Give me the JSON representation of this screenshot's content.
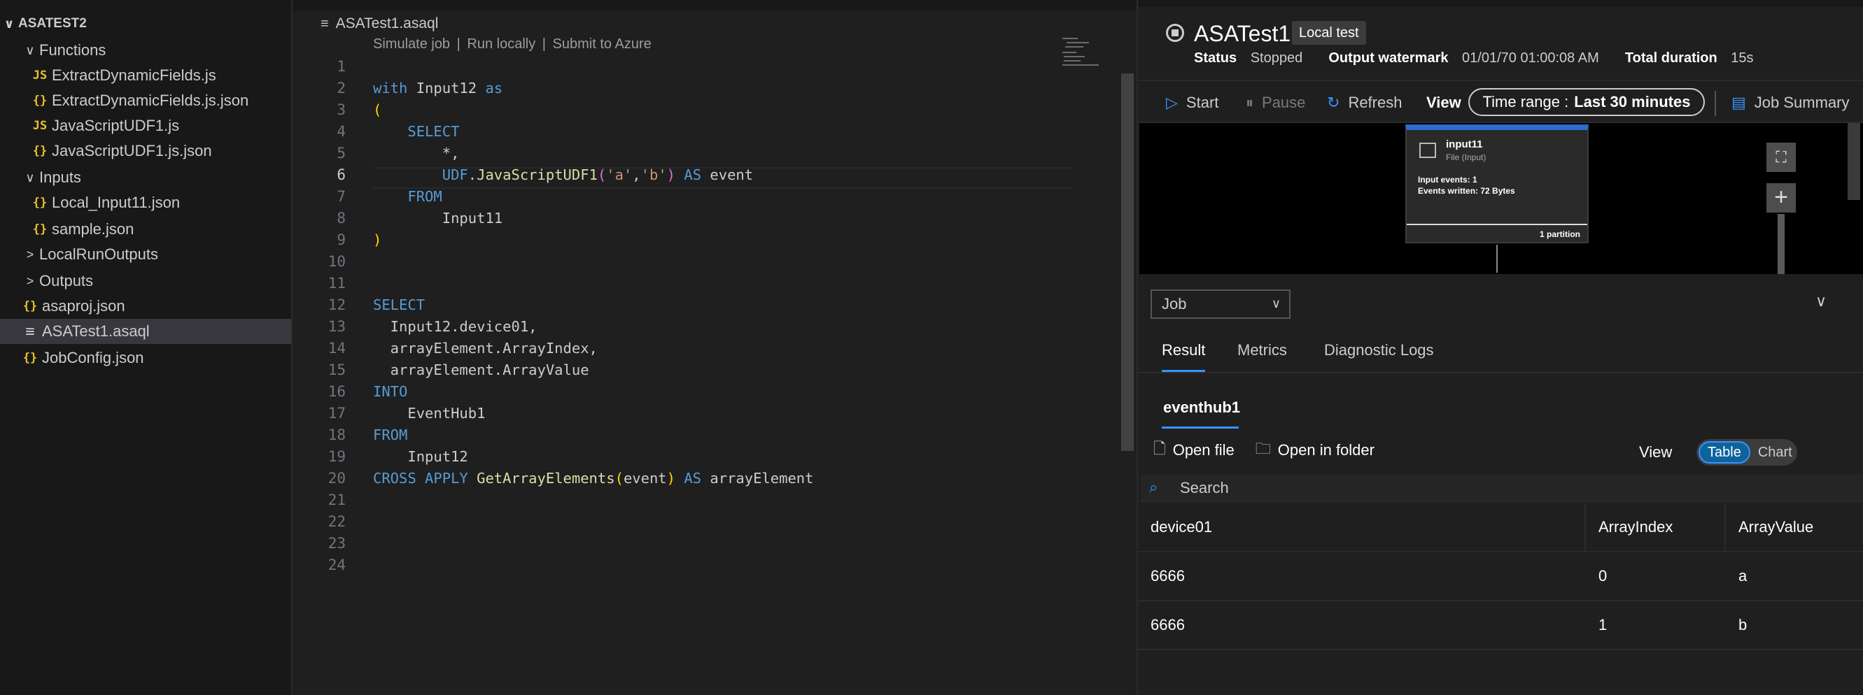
{
  "explorer": {
    "root": "ASATEST2",
    "rows": [
      {
        "label": "Functions",
        "kind": "folder-open"
      },
      {
        "label": "ExtractDynamicFields.js",
        "kind": "js"
      },
      {
        "label": "ExtractDynamicFields.js.json",
        "kind": "json"
      },
      {
        "label": "JavaScriptUDF1.js",
        "kind": "js"
      },
      {
        "label": "JavaScriptUDF1.js.json",
        "kind": "json"
      },
      {
        "label": "Inputs",
        "kind": "folder-open"
      },
      {
        "label": "Local_Input11.json",
        "kind": "json"
      },
      {
        "label": "sample.json",
        "kind": "json"
      },
      {
        "label": "LocalRunOutputs",
        "kind": "folder-closed"
      },
      {
        "label": "Outputs",
        "kind": "folder-closed"
      },
      {
        "label": "asaproj.json",
        "kind": "json"
      },
      {
        "label": "ASATest1.asaql",
        "kind": "asaql",
        "selected": true
      },
      {
        "label": "JobConfig.json",
        "kind": "json"
      }
    ],
    "icons": {
      "json": "{}",
      "js": "JS",
      "asaql": "≡",
      "chevron_open": "∨",
      "chevron_closed": ">"
    }
  },
  "editor": {
    "tab_label": "ASATest1.asaql",
    "codelens": {
      "simulate": "Simulate job",
      "run": "Run locally",
      "submit": "Submit to Azure",
      "sep": "|"
    },
    "line_numbers": [
      "1",
      "2",
      "3",
      "4",
      "5",
      "6",
      "7",
      "8",
      "9",
      "10",
      "11",
      "12",
      "13",
      "14",
      "15",
      "16",
      "17",
      "18",
      "19",
      "20",
      "21",
      "22",
      "23",
      "24"
    ],
    "active_line": 6
  },
  "panel": {
    "title": "ASATest1",
    "badge": "Local test",
    "status_label": "Status",
    "status_value": "Stopped",
    "watermark_label": "Output watermark",
    "watermark_value": "01/01/70 01:00:08 AM",
    "duration_label": "Total duration",
    "duration_value": "15s",
    "toolbar": {
      "start": "Start",
      "pause": "Pause",
      "refresh": "Refresh",
      "view": "View",
      "time_range_label": "Time range :",
      "time_range_value": "Last 30 minutes",
      "job_summary": "Job Summary"
    },
    "diagram": {
      "node_name": "input11",
      "node_type": "File (Input)",
      "input_events": "Input events:  1",
      "events_written": "Events written:  72 Bytes",
      "partitions": "1 partition"
    },
    "job_select": "Job",
    "tabs": [
      "Result",
      "Metrics",
      "Diagnostic Logs"
    ],
    "active_tab": "Result",
    "output_name": "eventhub1",
    "open_file": "Open file",
    "open_folder": "Open in folder",
    "view_label": "View",
    "view_options": [
      "Table",
      "Chart"
    ],
    "view_selected": "Table",
    "search_placeholder": "Search",
    "table": {
      "columns": [
        "device01",
        "ArrayIndex",
        "ArrayValue"
      ],
      "rows": [
        [
          "6666",
          "0",
          "a"
        ],
        [
          "6666",
          "1",
          "b"
        ]
      ]
    }
  },
  "colors": {
    "keyword": "#569cd6",
    "function": "#dcdcaa",
    "string": "#ce9178",
    "accent": "#3794ff"
  }
}
